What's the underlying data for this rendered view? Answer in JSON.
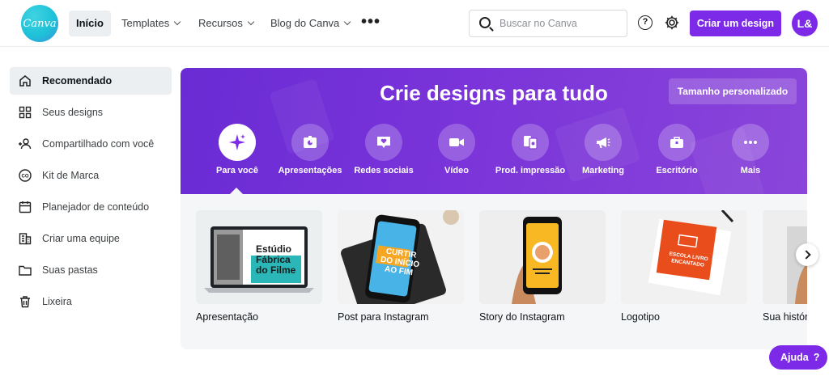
{
  "brand": {
    "logo_text": "Canva",
    "accent": "#7d2ae8",
    "hero_color": "#7a34d9",
    "logo_color": "#1ec2d8"
  },
  "nav": {
    "items": [
      {
        "label": "Início",
        "active": true,
        "dropdown": false
      },
      {
        "label": "Templates",
        "active": false,
        "dropdown": true
      },
      {
        "label": "Recursos",
        "active": false,
        "dropdown": true
      },
      {
        "label": "Blog do Canva",
        "active": false,
        "dropdown": true
      }
    ],
    "more_icon": "more-horizontal-icon"
  },
  "search": {
    "placeholder": "Buscar no Canva",
    "icon": "search-icon"
  },
  "header_actions": {
    "help_symbol": "?",
    "settings_icon": "gear-icon",
    "create_label": "Criar um design",
    "avatar_initials": "L&"
  },
  "sidebar": {
    "items": [
      {
        "label": "Recomendado",
        "icon": "home-icon",
        "active": true
      },
      {
        "label": "Seus designs",
        "icon": "grid-icon",
        "active": false
      },
      {
        "label": "Compartilhado com você",
        "icon": "add-user-icon",
        "active": false
      },
      {
        "label": "Kit de Marca",
        "icon": "brand-kit-icon",
        "active": false
      },
      {
        "label": "Planejador de conteúdo",
        "icon": "calendar-icon",
        "active": false
      },
      {
        "label": "Criar uma equipe",
        "icon": "building-icon",
        "active": false
      },
      {
        "label": "Suas pastas",
        "icon": "folder-icon",
        "active": false
      },
      {
        "label": "Lixeira",
        "icon": "trash-icon",
        "active": false
      }
    ]
  },
  "hero": {
    "title": "Crie designs para tudo",
    "custom_size_label": "Tamanho personalizado",
    "categories": [
      {
        "label": "Para você",
        "icon": "sparkle-icon",
        "active": true
      },
      {
        "label": "Apresentações",
        "icon": "presentation-icon",
        "active": false
      },
      {
        "label": "Redes sociais",
        "icon": "heart-chat-icon",
        "active": false
      },
      {
        "label": "Vídeo",
        "icon": "video-camera-icon",
        "active": false
      },
      {
        "label": "Prod. impressão",
        "icon": "print-product-icon",
        "active": false
      },
      {
        "label": "Marketing",
        "icon": "megaphone-icon",
        "active": false
      },
      {
        "label": "Escritório",
        "icon": "briefcase-icon",
        "active": false
      },
      {
        "label": "Mais",
        "icon": "more-icon",
        "active": false
      }
    ]
  },
  "templates": [
    {
      "label": "Apresentação",
      "thumb_text": "Estúdio Fábrica do Filme"
    },
    {
      "label": "Post para Instagram",
      "thumb_text": "CURTIR DO INÍCIO AO FIM"
    },
    {
      "label": "Story do Instagram",
      "thumb_text": ""
    },
    {
      "label": "Logotipo",
      "thumb_text": "ESCOLA LIVRO ENCANTADO"
    },
    {
      "label": "Sua história",
      "thumb_text": ""
    }
  ],
  "help": {
    "label": "Ajuda",
    "symbol": "?"
  }
}
